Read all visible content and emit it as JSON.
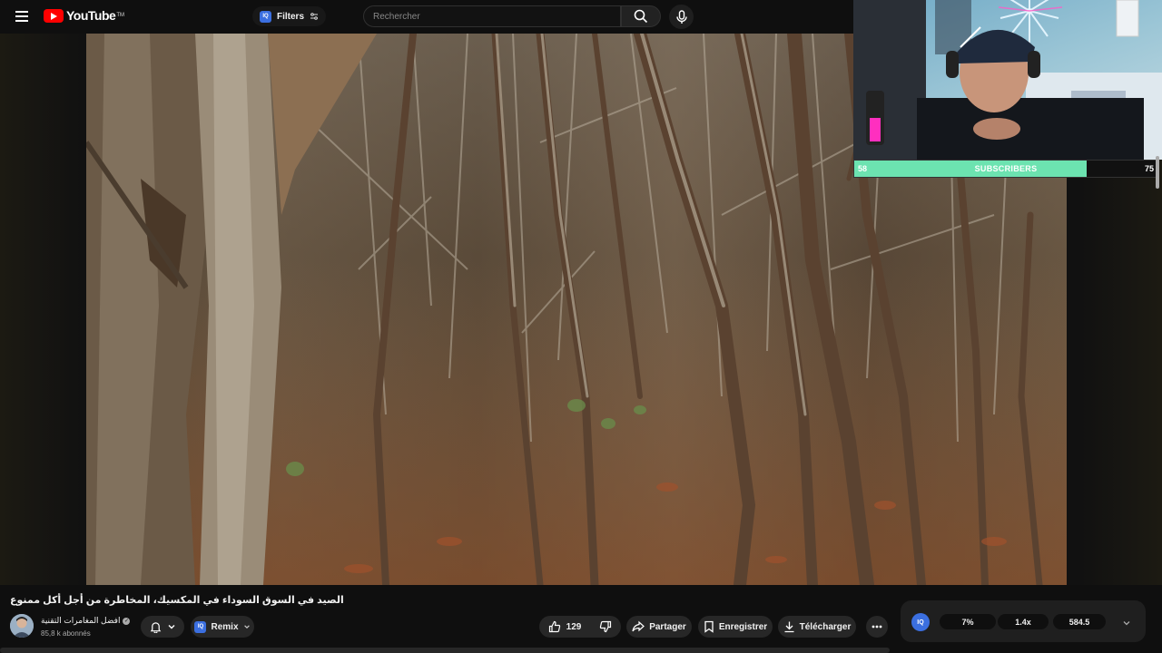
{
  "header": {
    "logo_text": "YouTube",
    "logo_tm": "TM",
    "filters_label": "Filters",
    "search_placeholder": "Rechercher",
    "iq_badge": "IQ"
  },
  "overlay": {
    "subscribers_current": "58",
    "subscribers_label": "SUBSCRIBERS",
    "subscribers_goal": "75",
    "subscribers_progress": 0.77
  },
  "video": {
    "title": "الصيد في السوق السوداء في المكسيك، المخاطرة من أجل أكل ممنوع"
  },
  "channel": {
    "name": "افضل المغامرات التقنية",
    "subscribers": "85,8 k abonnés"
  },
  "actions": {
    "remix_label": "Remix",
    "likes": "129",
    "share_label": "Partager",
    "save_label": "Enregistrer",
    "download_label": "Télécharger"
  },
  "stats_widget": {
    "logo": "IQ",
    "stat_1": "7%",
    "stat_2": "1.4x",
    "stat_3": "584.5"
  },
  "colors": {
    "brand_red": "#ff0000",
    "progress_green": "#6ce3b0",
    "iq_blue": "#3b6fe0"
  }
}
